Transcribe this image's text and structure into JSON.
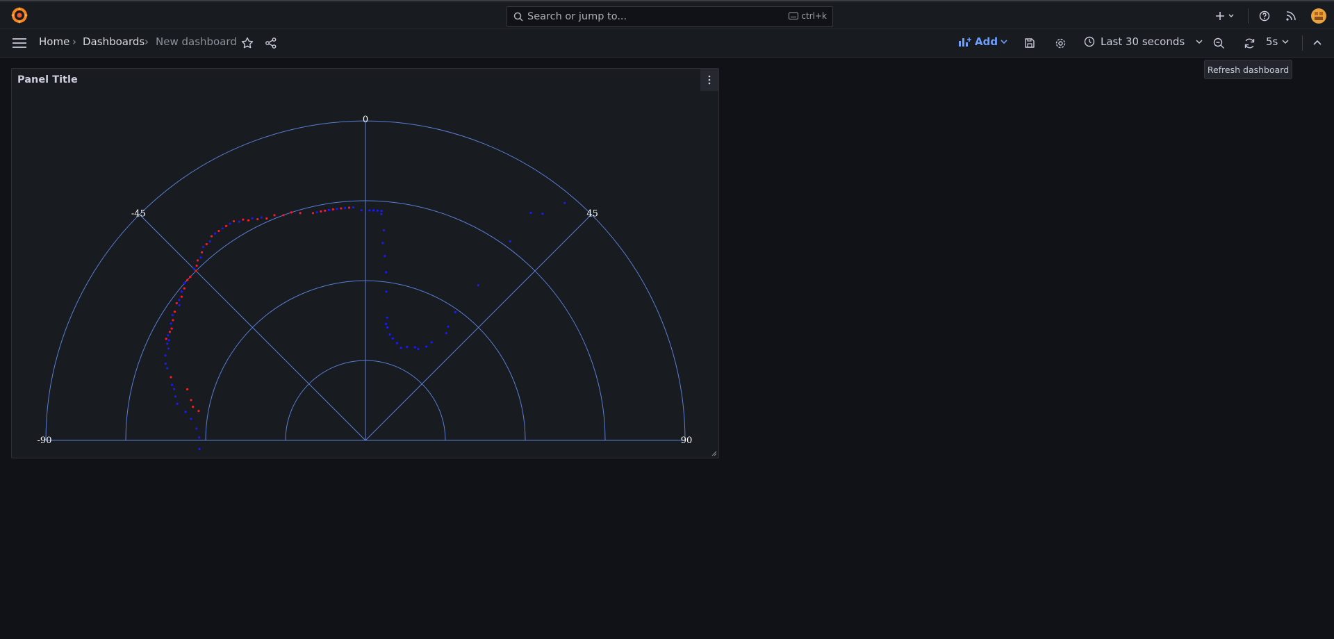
{
  "search": {
    "placeholder": "Search or jump to...",
    "shortcut": "ctrl+k"
  },
  "breadcrumb": {
    "home": "Home",
    "dashboards": "Dashboards",
    "current": "New dashboard"
  },
  "toolbar": {
    "add_label": "Add",
    "time_range": "Last 30 seconds",
    "refresh_interval": "5s"
  },
  "tooltip": {
    "refresh": "Refresh dashboard"
  },
  "panel": {
    "title": "Panel Title"
  },
  "colors": {
    "accent": "#6e9fff",
    "grid": "#5b7fd6",
    "series_blue": "#1a1aff",
    "series_red": "#ff1a1a"
  },
  "chart_data": {
    "type": "scatter",
    "subtype": "polar-semicircle",
    "angular_ticks": [
      "-90",
      "-45",
      "0",
      "45",
      "90"
    ],
    "series": [
      {
        "color": "blue",
        "points": [
          [
            52,
            -93
          ],
          [
            52,
            -89
          ],
          [
            53,
            -86
          ],
          [
            55,
            -83
          ],
          [
            57,
            -81
          ],
          [
            60,
            -79
          ],
          [
            61,
            -77
          ],
          [
            62,
            -75
          ],
          [
            63,
            -74
          ],
          [
            64,
            -72
          ],
          [
            66,
            -70
          ],
          [
            67,
            -69
          ],
          [
            68,
            -67
          ],
          [
            68,
            -65
          ],
          [
            69,
            -64
          ],
          [
            69,
            -63
          ],
          [
            70,
            -62
          ],
          [
            70,
            -61
          ],
          [
            70,
            -60
          ],
          [
            70,
            -60
          ],
          [
            70,
            -60
          ],
          [
            71,
            -59
          ],
          [
            71,
            -58
          ],
          [
            72,
            -57
          ],
          [
            72,
            -56
          ],
          [
            72,
            -54
          ],
          [
            73,
            -53
          ],
          [
            73,
            -52
          ],
          [
            74,
            -51
          ],
          [
            74,
            -50
          ],
          [
            75,
            -49
          ],
          [
            75,
            -48
          ],
          [
            75,
            -47
          ],
          [
            76,
            -45
          ],
          [
            76,
            -44
          ],
          [
            77,
            -43
          ],
          [
            77,
            -42
          ],
          [
            78,
            -41
          ],
          [
            79,
            -40
          ],
          [
            79,
            -39
          ],
          [
            79,
            -38
          ],
          [
            80,
            -37
          ],
          [
            80,
            -36
          ],
          [
            80,
            -34
          ],
          [
            80,
            -32
          ],
          [
            80,
            -31
          ],
          [
            79,
            -30
          ],
          [
            79,
            -29
          ],
          [
            78,
            -27
          ],
          [
            77,
            -25
          ],
          [
            76,
            -24
          ],
          [
            76,
            -22
          ],
          [
            75,
            -20
          ],
          [
            75,
            -18
          ],
          [
            74,
            -16
          ],
          [
            73,
            -12
          ],
          [
            73,
            -11
          ],
          [
            73,
            -10
          ],
          [
            73,
            -9
          ],
          [
            73,
            -9
          ],
          [
            73,
            -8
          ],
          [
            73,
            -7
          ],
          [
            73,
            -6
          ],
          [
            73,
            -5
          ],
          [
            73,
            -4
          ],
          [
            73,
            -3
          ],
          [
            72,
            -1
          ],
          [
            72,
            1
          ],
          [
            72,
            2
          ],
          [
            72,
            3
          ],
          [
            72,
            4
          ],
          [
            71,
            4
          ],
          [
            66,
            5
          ],
          [
            62,
            5
          ],
          [
            58,
            6
          ],
          [
            53,
            7
          ],
          [
            47,
            8
          ],
          [
            39,
            10
          ],
          [
            37,
            10
          ],
          [
            36,
            11
          ],
          [
            34,
            13
          ],
          [
            33,
            15
          ],
          [
            32,
            18
          ],
          [
            31,
            21
          ],
          [
            32,
            24
          ],
          [
            33,
            28
          ],
          [
            33,
            30
          ],
          [
            35,
            33
          ],
          [
            37,
            34
          ],
          [
            42,
            37
          ],
          [
            44,
            36
          ],
          [
            49,
            35
          ],
          [
            60,
            36
          ],
          [
            77,
            36
          ],
          [
            88,
            36
          ],
          [
            90,
            38
          ],
          [
            97,
            40
          ]
        ]
      },
      {
        "color": "red",
        "points": [
          [
            53,
            -80
          ],
          [
            55,
            -79
          ],
          [
            56,
            -77
          ],
          [
            58,
            -74
          ],
          [
            64,
            -72
          ],
          [
            70,
            -63
          ],
          [
            70,
            -61
          ],
          [
            70,
            -60
          ],
          [
            71,
            -58
          ],
          [
            72,
            -56
          ],
          [
            73,
            -54
          ],
          [
            73,
            -52
          ],
          [
            74,
            -50
          ],
          [
            75,
            -48
          ],
          [
            75,
            -47
          ],
          [
            75,
            -45
          ],
          [
            76,
            -44
          ],
          [
            77,
            -43
          ],
          [
            78,
            -41
          ],
          [
            79,
            -39
          ],
          [
            80,
            -37
          ],
          [
            80,
            -35
          ],
          [
            80,
            -33
          ],
          [
            80,
            -31
          ],
          [
            79,
            -29
          ],
          [
            78,
            -28
          ],
          [
            77,
            -26
          ],
          [
            76,
            -24
          ],
          [
            76,
            -22
          ],
          [
            75,
            -20
          ],
          [
            75,
            -18
          ],
          [
            74,
            -16
          ],
          [
            73,
            -13
          ],
          [
            73,
            -11
          ],
          [
            73,
            -10
          ],
          [
            73,
            -8
          ],
          [
            73,
            -6
          ],
          [
            73,
            -4
          ]
        ]
      }
    ]
  }
}
